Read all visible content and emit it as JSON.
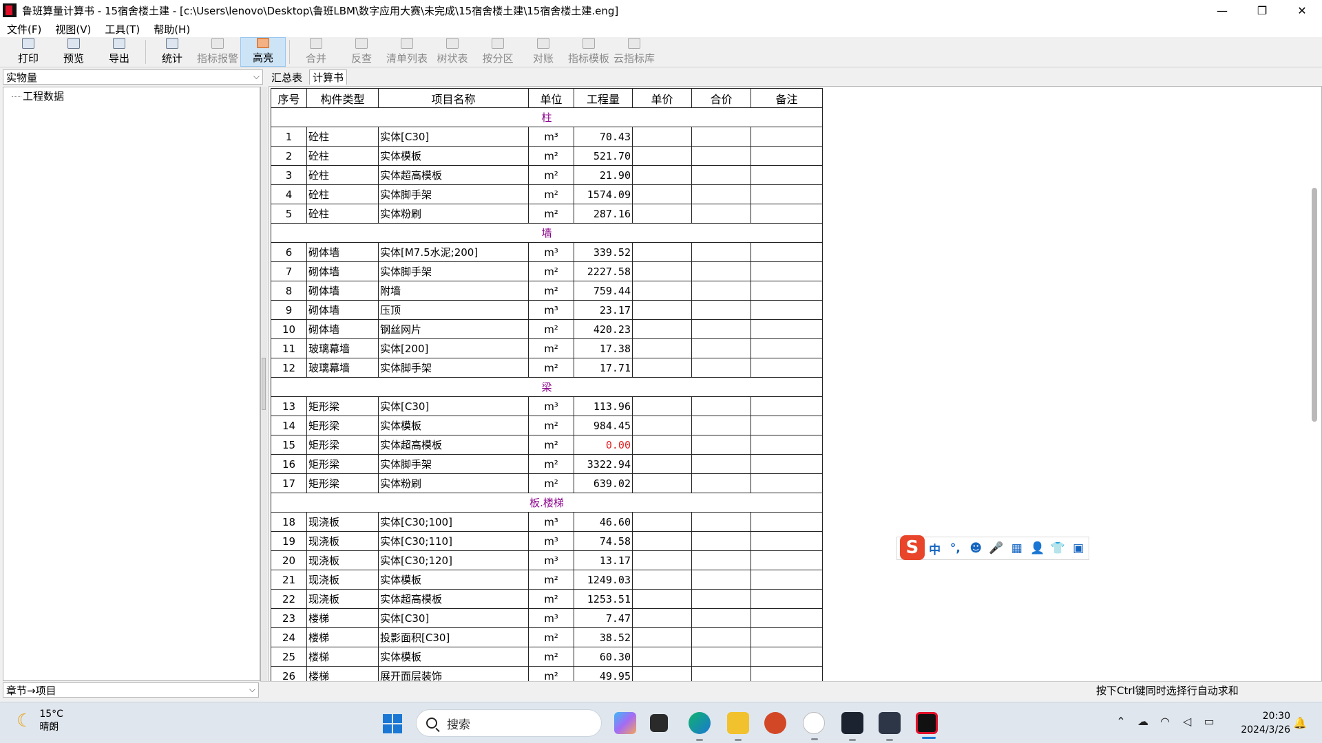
{
  "window": {
    "title": "鲁班算量计算书 - 15宿舍楼土建 - [c:\\Users\\lenovo\\Desktop\\鲁班LBM\\数字应用大赛\\未完成\\15宿舍楼土建\\15宿舍楼土建.eng]",
    "minimize": "—",
    "restore": "❐",
    "close": "✕"
  },
  "menu": [
    "文件(F)",
    "视图(V)",
    "工具(T)",
    "帮助(H)"
  ],
  "toolbar": {
    "group1": [
      "打印",
      "预览",
      "导出"
    ],
    "group2": [
      "统计",
      "指标报警",
      "高亮"
    ],
    "group3": [
      "合并",
      "反查",
      "清单列表",
      "树状表",
      "按分区",
      "对账",
      "指标模板",
      "云指标库"
    ]
  },
  "left": {
    "dropdown": "实物量",
    "tree_root": "工程数据",
    "bottom_dropdown": "章节→项目"
  },
  "tabs": [
    "汇总表",
    "计算书"
  ],
  "table": {
    "headers": [
      "序号",
      "构件类型",
      "项目名称",
      "单位",
      "工程量",
      "单价",
      "合价",
      "备注"
    ],
    "sections": [
      {
        "title": "柱",
        "rows": [
          [
            "1",
            "砼柱",
            "实体[C30]",
            "m³",
            "70.43"
          ],
          [
            "2",
            "砼柱",
            "实体模板",
            "m²",
            "521.70"
          ],
          [
            "3",
            "砼柱",
            "实体超高模板",
            "m²",
            "21.90"
          ],
          [
            "4",
            "砼柱",
            "实体脚手架",
            "m²",
            "1574.09"
          ],
          [
            "5",
            "砼柱",
            "实体粉刷",
            "m²",
            "287.16"
          ]
        ]
      },
      {
        "title": "墙",
        "rows": [
          [
            "6",
            "砌体墙",
            "实体[M7.5水泥;200]",
            "m³",
            "339.52"
          ],
          [
            "7",
            "砌体墙",
            "实体脚手架",
            "m²",
            "2227.58"
          ],
          [
            "8",
            "砌体墙",
            "附墙",
            "m²",
            "759.44"
          ],
          [
            "9",
            "砌体墙",
            "压顶",
            "m³",
            "23.17"
          ],
          [
            "10",
            "砌体墙",
            "钢丝网片",
            "m²",
            "420.23"
          ],
          [
            "11",
            "玻璃幕墙",
            "实体[200]",
            "m²",
            "17.38"
          ],
          [
            "12",
            "玻璃幕墙",
            "实体脚手架",
            "m²",
            "17.71"
          ]
        ]
      },
      {
        "title": "梁",
        "rows": [
          [
            "13",
            "矩形梁",
            "实体[C30]",
            "m³",
            "113.96"
          ],
          [
            "14",
            "矩形梁",
            "实体模板",
            "m²",
            "984.45"
          ],
          [
            "15",
            "矩形梁",
            "实体超高模板",
            "m²",
            "0.00"
          ],
          [
            "16",
            "矩形梁",
            "实体脚手架",
            "m²",
            "3322.94"
          ],
          [
            "17",
            "矩形梁",
            "实体粉刷",
            "m²",
            "639.02"
          ]
        ]
      },
      {
        "title": "板.楼梯",
        "rows": [
          [
            "18",
            "现浇板",
            "实体[C30;100]",
            "m³",
            "46.60"
          ],
          [
            "19",
            "现浇板",
            "实体[C30;110]",
            "m³",
            "74.58"
          ],
          [
            "20",
            "现浇板",
            "实体[C30;120]",
            "m³",
            "13.17"
          ],
          [
            "21",
            "现浇板",
            "实体模板",
            "m²",
            "1249.03"
          ],
          [
            "22",
            "现浇板",
            "实体超高模板",
            "m²",
            "1253.51"
          ],
          [
            "23",
            "楼梯",
            "实体[C30]",
            "m³",
            "7.47"
          ],
          [
            "24",
            "楼梯",
            "投影面积[C30]",
            "m²",
            "38.52"
          ],
          [
            "25",
            "楼梯",
            "实体模板",
            "m²",
            "60.30"
          ],
          [
            "26",
            "楼梯",
            "展开面层装饰",
            "m²",
            "49.95"
          ]
        ]
      }
    ]
  },
  "status_hint": "按下Ctrl键同时选择行自动求和",
  "ime": {
    "logo": "S",
    "items": [
      "中",
      "°,",
      "☻",
      "🎤",
      "▦",
      "👤",
      "👕",
      "▣"
    ]
  },
  "taskbar": {
    "temperature": "15°C",
    "weather": "晴朗",
    "search_placeholder": "搜索",
    "time": "20:30",
    "date": "2024/3/26"
  },
  "colors": {
    "section_title": "#8b008b",
    "zero_value": "#e02020",
    "active_tool": "#cde4f7"
  }
}
